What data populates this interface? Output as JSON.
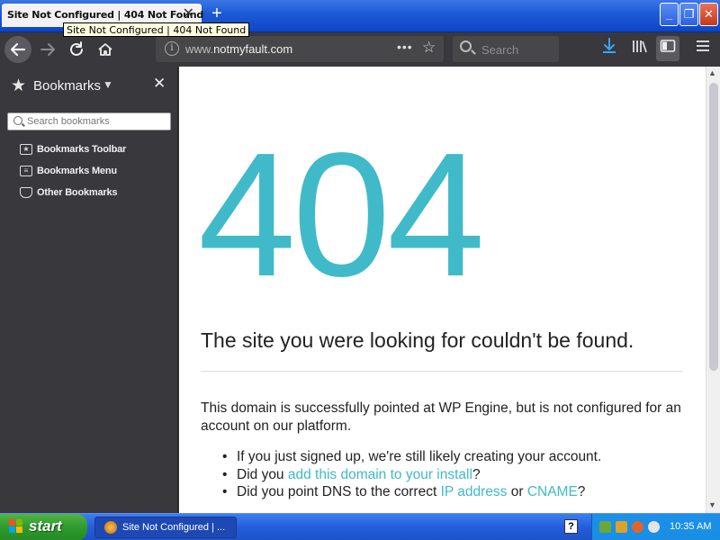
{
  "browser": {
    "tab": {
      "title": "Site Not Configured | 404 Not Found",
      "close": "✕"
    },
    "new_tab": "+",
    "tooltip": "Site Not Configured | 404 Not Found",
    "window_buttons": {
      "minimize": "_",
      "maximize": "❐",
      "close": "✕"
    },
    "toolbar": {
      "url_prefix": "www.",
      "url_domain": "notmyfault.com",
      "page_actions": "•••",
      "search_placeholder": "Search"
    }
  },
  "sidebar": {
    "title": "Bookmarks",
    "search_placeholder": "Search bookmarks",
    "items": [
      {
        "label": "Bookmarks Toolbar"
      },
      {
        "label": "Bookmarks Menu"
      },
      {
        "label": "Other Bookmarks"
      }
    ]
  },
  "page": {
    "code": "404",
    "headline": "The site you were looking for couldn't be found.",
    "paragraph": "This domain is successfully pointed at WP Engine, but is not configured for an account on our platform.",
    "bullets": {
      "b1": "If you just signed up, we're still likely creating your account.",
      "b2_pre": "Did you ",
      "b2_link": "add this domain to your install",
      "b2_post": "?",
      "b3_pre": "Did you point DNS to the correct ",
      "b3_link1": "IP address",
      "b3_mid": " or ",
      "b3_link2": "CNAME",
      "b3_post": "?"
    },
    "accent_color": "#40bac8"
  },
  "taskbar": {
    "start": "start",
    "task_label": "Site Not Configured | ...",
    "help": "?",
    "clock": "10:35 AM"
  }
}
